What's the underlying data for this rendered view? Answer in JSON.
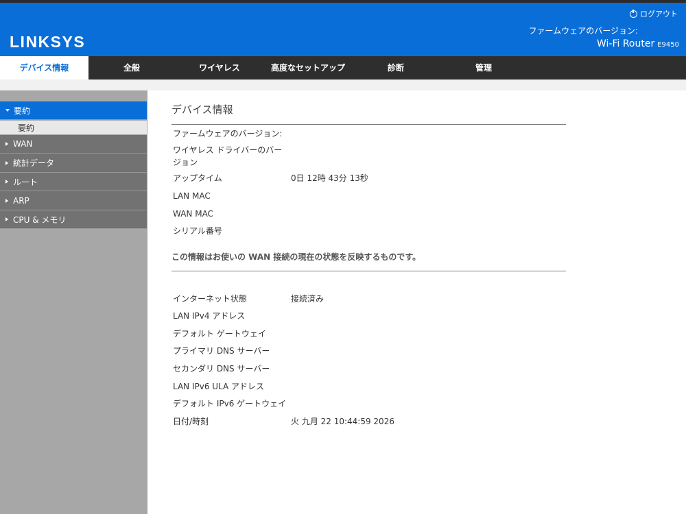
{
  "header": {
    "brand": "LINKSYS",
    "logout_label": "ログアウト",
    "firmware_label": "ファームウェアのバージョン:",
    "model_name": "Wi-Fi Router",
    "model_code": "E9450",
    "colors": {
      "brand_blue": "#0a6ed8",
      "nav_dark": "#2e2e2e"
    }
  },
  "nav": {
    "tabs": [
      {
        "label": "デバイス情報"
      },
      {
        "label": "全般"
      },
      {
        "label": "ワイヤレス"
      },
      {
        "label": "高度なセットアップ"
      },
      {
        "label": "診断"
      },
      {
        "label": "管理"
      }
    ],
    "active": "デバイス情報"
  },
  "sidebar": {
    "items": [
      {
        "label": "要約"
      },
      {
        "label": "要約"
      },
      {
        "label": "WAN"
      },
      {
        "label": "統計データ"
      },
      {
        "label": "ルート"
      },
      {
        "label": "ARP"
      },
      {
        "label": "CPU & メモリ"
      }
    ]
  },
  "main": {
    "title": "デバイス情報",
    "device_rows": [
      {
        "label": "ファームウェアのバージョン:",
        "value": ""
      },
      {
        "label": "ワイヤレス ドライバーのバージョン",
        "value": ""
      },
      {
        "label": "アップタイム",
        "value": "0日 12時 43分 13秒"
      },
      {
        "label": "LAN MAC",
        "value": ""
      },
      {
        "label": "WAN MAC",
        "value": ""
      },
      {
        "label": "シリアル番号",
        "value": ""
      }
    ],
    "note": "この情報はお使いの WAN 接続の現在の状態を反映するものです。",
    "wan_rows": [
      {
        "label": "インターネット状態",
        "value": "接続済み"
      },
      {
        "label": "LAN IPv4 アドレス",
        "value": ""
      },
      {
        "label": "デフォルト ゲートウェイ",
        "value": ""
      },
      {
        "label": "プライマリ DNS サーバー",
        "value": ""
      },
      {
        "label": "セカンダリ DNS サーバー",
        "value": ""
      },
      {
        "label": "LAN IPv6 ULA アドレス",
        "value": ""
      },
      {
        "label": "デフォルト IPv6 ゲートウェイ",
        "value": ""
      },
      {
        "label": "日付/時刻",
        "value": "火 九月 22 10:44:59 2026"
      }
    ]
  }
}
